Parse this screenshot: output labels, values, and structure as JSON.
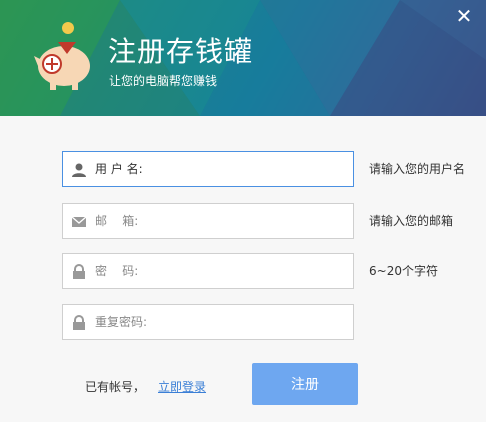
{
  "header": {
    "title": "注册存钱罐",
    "subtitle": "让您的电脑帮您赚钱",
    "close_icon": "close-icon"
  },
  "form": {
    "fields": [
      {
        "label": "用 户 名:",
        "hint": "请输入您的用户名",
        "icon": "user-icon",
        "value": ""
      },
      {
        "label": "邮    箱:",
        "hint": "请输入您的邮箱",
        "icon": "mail-icon",
        "value": ""
      },
      {
        "label": "密    码:",
        "hint": "6~20个字符",
        "icon": "lock-icon",
        "value": ""
      },
      {
        "label": "重复密码:",
        "hint": "",
        "icon": "lock-icon",
        "value": ""
      }
    ]
  },
  "footer": {
    "have_account": "已有帐号，",
    "login_link": "立即登录",
    "register_button": "注册"
  },
  "colors": {
    "accent": "#6ea7f0",
    "link": "#3b7fd6",
    "active_border": "#4a90e2"
  }
}
